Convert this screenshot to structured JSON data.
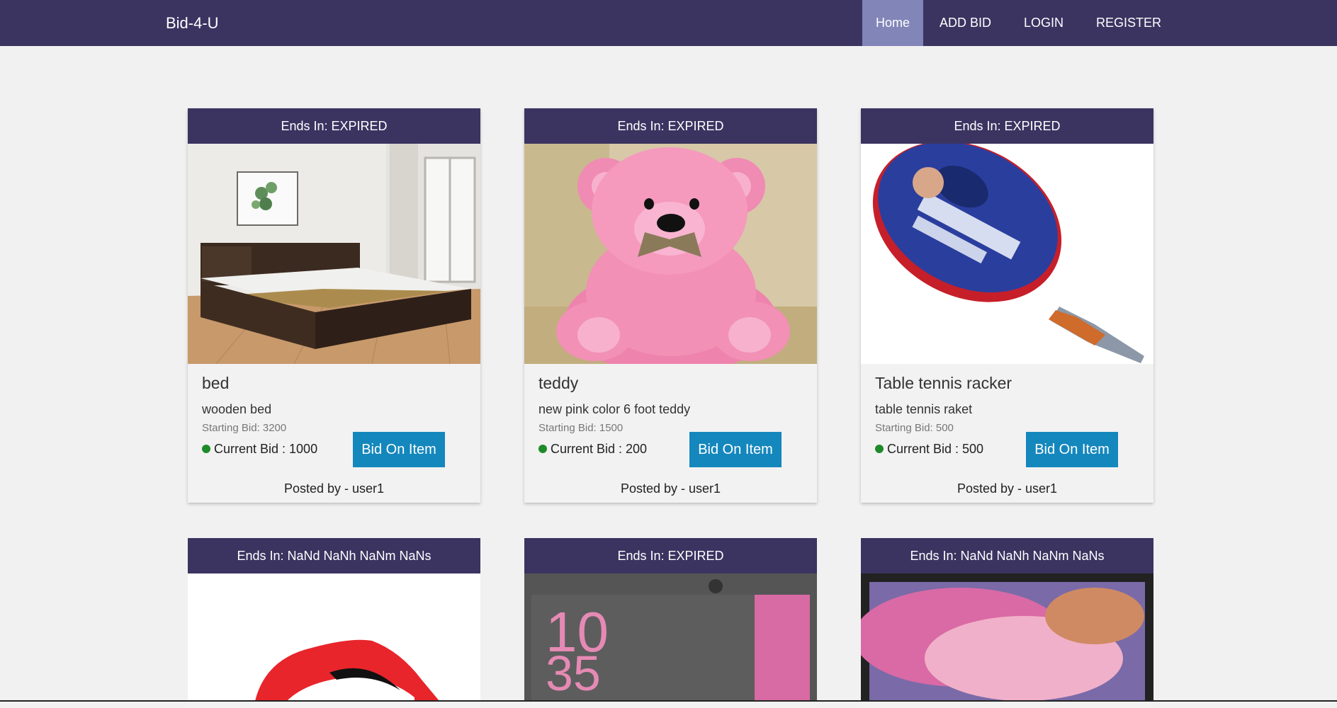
{
  "nav": {
    "brand": "Bid-4-U",
    "links": [
      "Home",
      "ADD BID",
      "LOGIN",
      "REGISTER"
    ]
  },
  "cards": [
    {
      "ends": "Ends In: EXPIRED",
      "title": "bed",
      "desc": "wooden bed",
      "start": "Starting Bid: 3200",
      "current": "Current Bid : 1000",
      "button": "Bid On Item",
      "posted": "Posted by - user1"
    },
    {
      "ends": "Ends In: EXPIRED",
      "title": "teddy",
      "desc": "new pink color 6 foot teddy",
      "start": "Starting Bid: 1500",
      "current": "Current Bid : 200",
      "button": "Bid On Item",
      "posted": "Posted by - user1"
    },
    {
      "ends": "Ends In: EXPIRED",
      "title": "Table tennis racker",
      "desc": "table tennis raket",
      "start": "Starting Bid: 500",
      "current": "Current Bid : 500",
      "button": "Bid On Item",
      "posted": "Posted by - user1"
    },
    {
      "ends": "Ends In: NaNd NaNh NaNm NaNs"
    },
    {
      "ends": "Ends In: EXPIRED"
    },
    {
      "ends": "Ends In: NaNd NaNh NaNm NaNs"
    }
  ]
}
